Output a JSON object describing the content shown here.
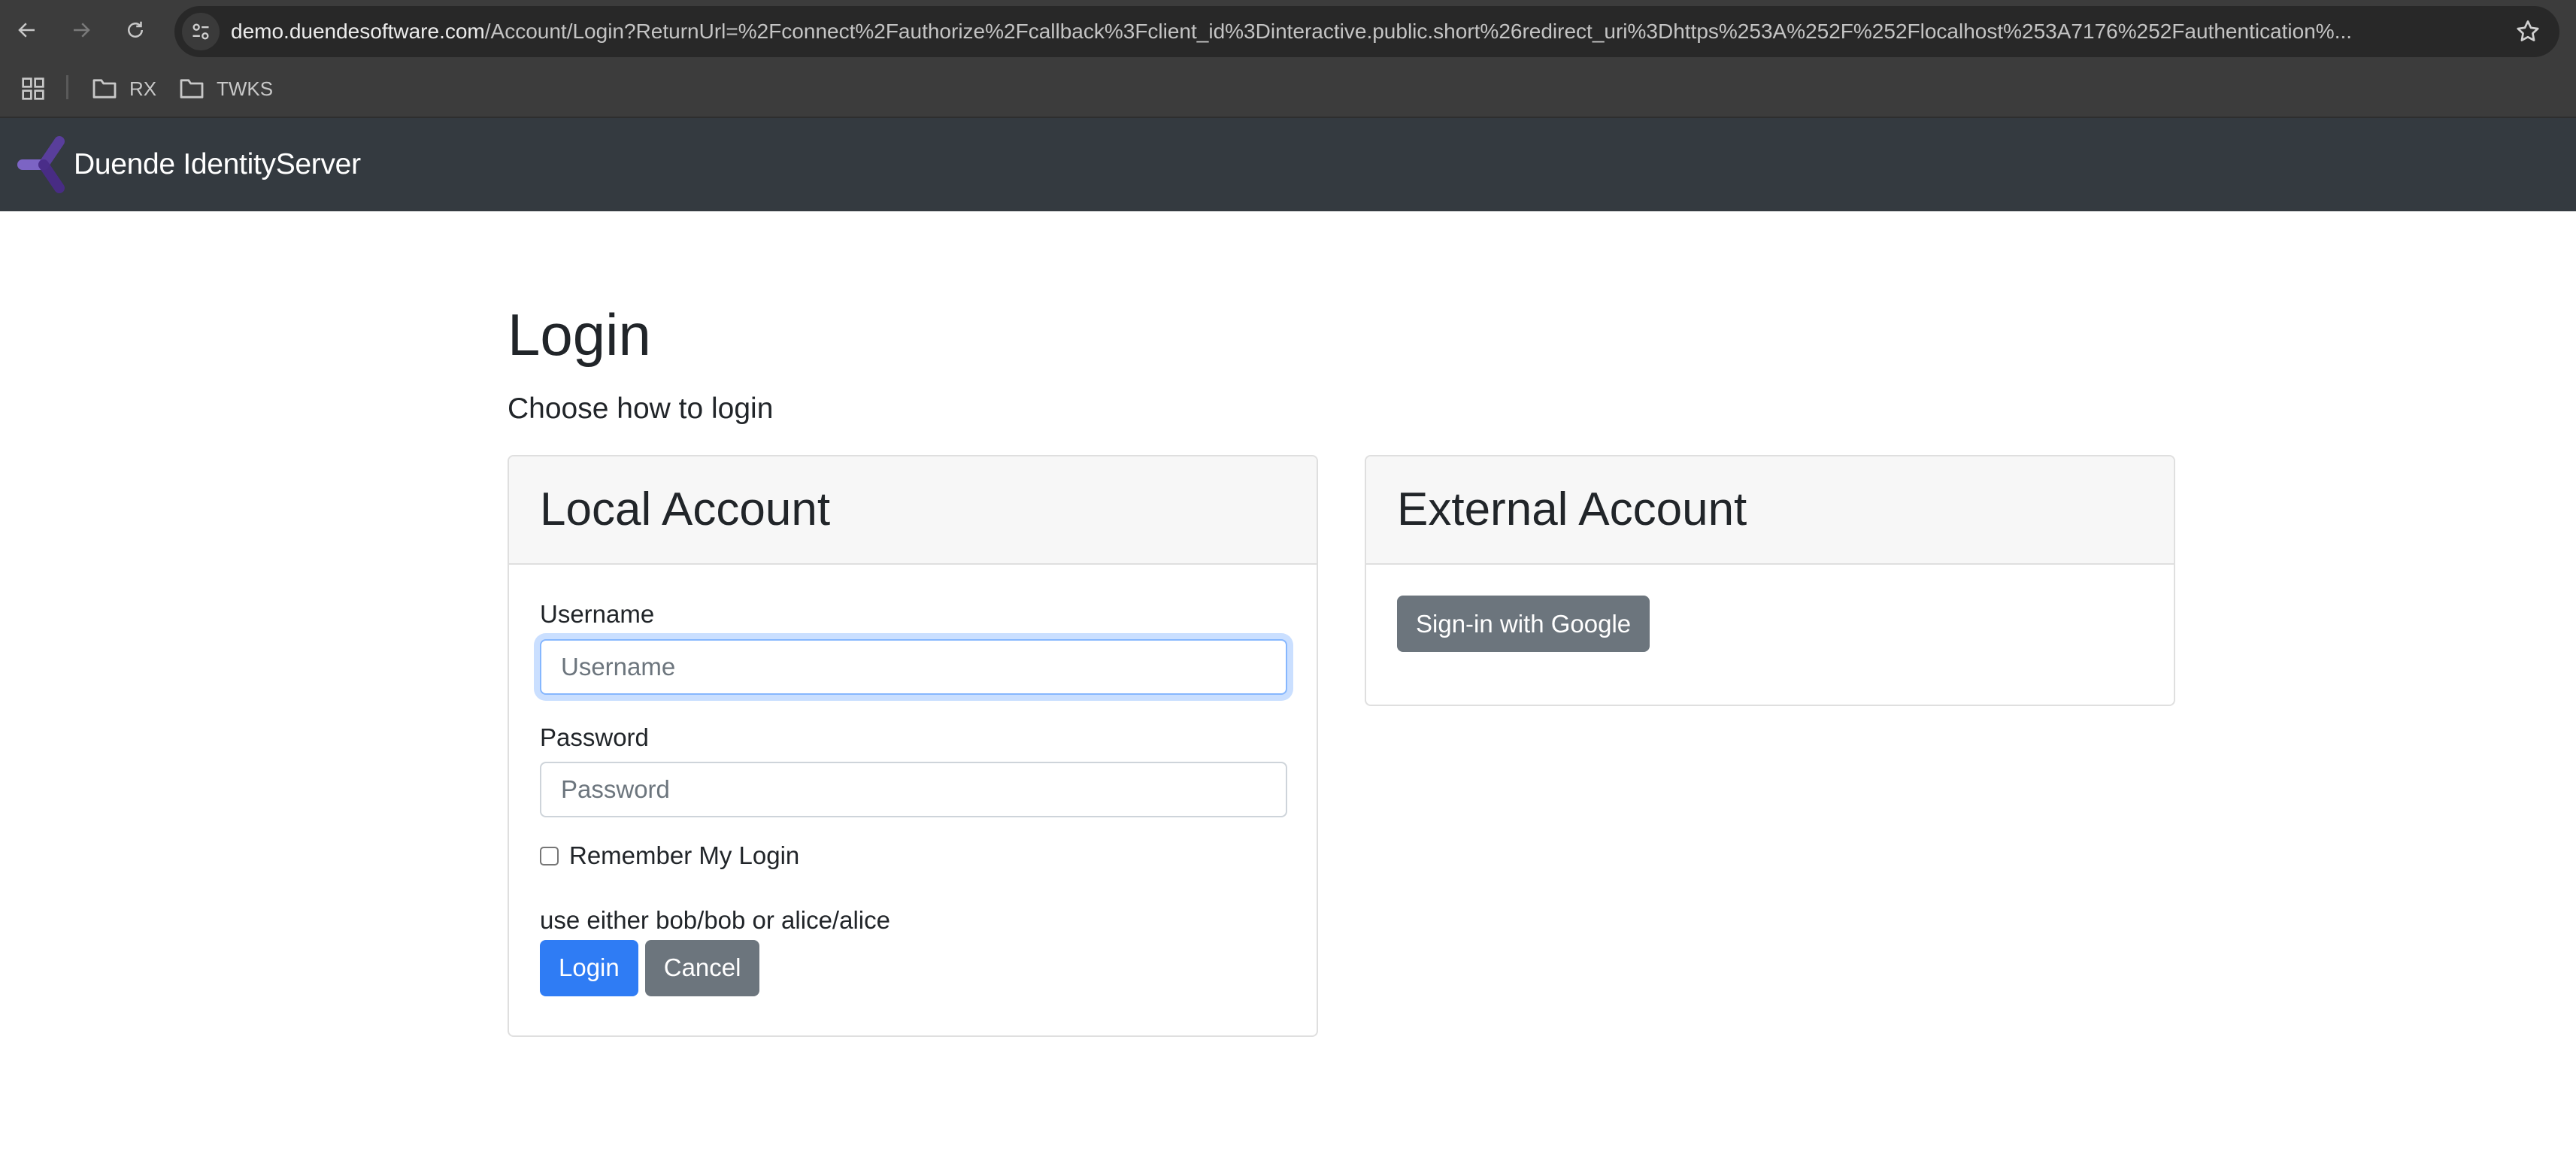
{
  "browser": {
    "url_host": "demo.duendesoftware.com",
    "url_path": "/Account/Login?ReturnUrl=%2Fconnect%2Fauthorize%2Fcallback%3Fclient_id%3Dinteractive.public.short%26redirect_uri%3Dhttps%253A%252F%252Flocalhost%253A7176%252Fauthentication%...",
    "bookmarks": [
      {
        "label": "RX",
        "icon": "folder-icon"
      },
      {
        "label": "TWKS",
        "icon": "folder-icon"
      }
    ]
  },
  "navbar": {
    "brand": "Duende IdentityServer",
    "logo_colors": [
      "#7c64c4",
      "#5b3fa0",
      "#4a2c88"
    ]
  },
  "page": {
    "title": "Login",
    "subtitle": "Choose how to login"
  },
  "local_account": {
    "header": "Local Account",
    "username_label": "Username",
    "username_placeholder": "Username",
    "username_value": "",
    "password_label": "Password",
    "password_placeholder": "Password",
    "password_value": "",
    "remember_label": "Remember My Login",
    "remember_checked": false,
    "hint": "use either bob/bob or alice/alice",
    "login_button": "Login",
    "cancel_button": "Cancel"
  },
  "external_account": {
    "header": "External Account",
    "google_button": "Sign-in with Google"
  },
  "colors": {
    "primary": "#2f7cf4",
    "secondary": "#6c757d",
    "navbar_bg": "#343a40"
  }
}
